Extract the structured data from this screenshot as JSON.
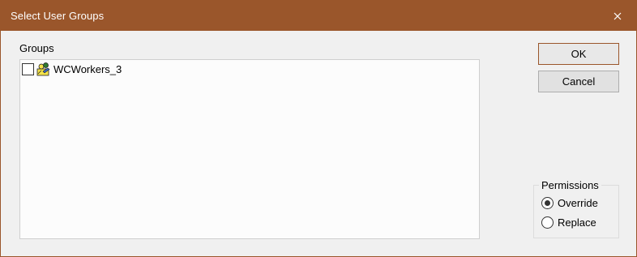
{
  "window": {
    "title": "Select User Groups",
    "accent_color": "#9a562b"
  },
  "icons": {
    "close": "close-icon",
    "group": "user-group-icon"
  },
  "groups": {
    "label": "Groups",
    "items": [
      {
        "label": "WCWorkers_3",
        "checked": false
      }
    ]
  },
  "buttons": {
    "ok_label": "OK",
    "cancel_label": "Cancel"
  },
  "permissions": {
    "legend": "Permissions",
    "options": [
      {
        "label": "Override",
        "selected": true
      },
      {
        "label": "Replace",
        "selected": false
      }
    ]
  }
}
